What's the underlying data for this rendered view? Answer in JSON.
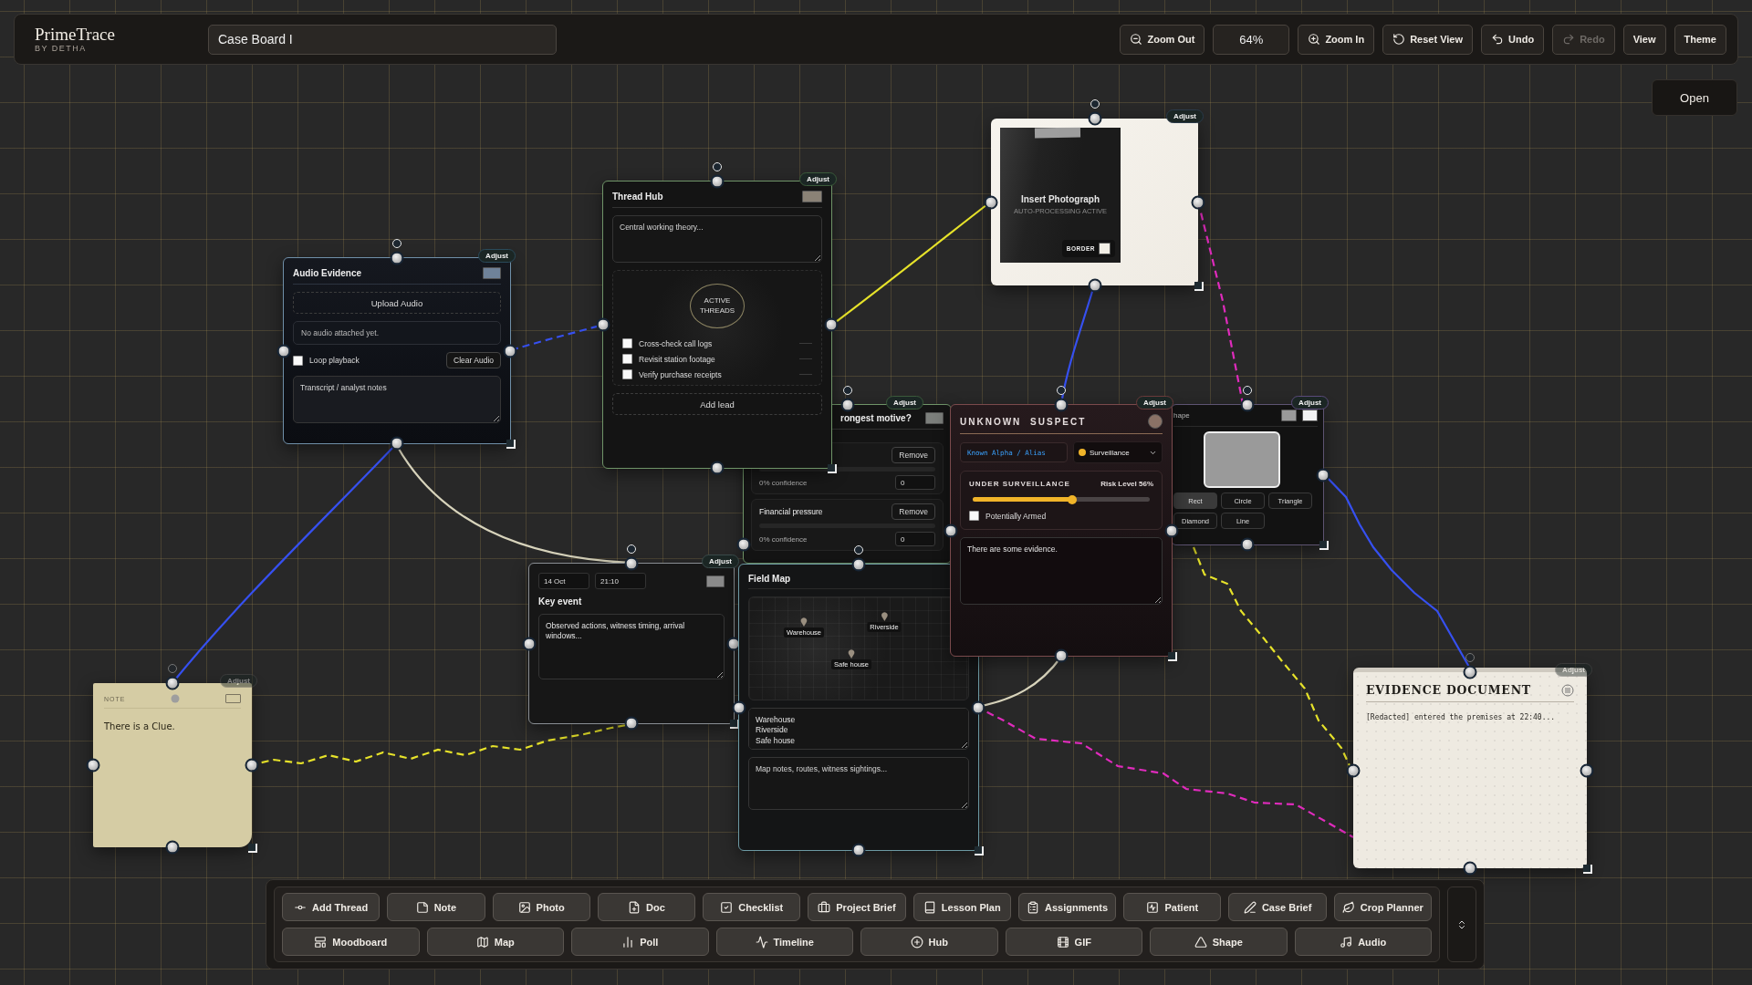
{
  "app": {
    "name": "PrimeTrace",
    "byline": "BY DETHA"
  },
  "board_title": "Case Board I",
  "controls": [
    {
      "kind": "button",
      "label": "Zoom Out",
      "disabled": false
    },
    {
      "kind": "readout",
      "label": "64%"
    },
    {
      "kind": "button",
      "label": "Zoom In",
      "disabled": false
    },
    {
      "kind": "button",
      "label": "Reset View",
      "disabled": false
    },
    {
      "kind": "button",
      "label": "Undo",
      "disabled": false
    },
    {
      "kind": "button",
      "label": "Redo",
      "disabled": true
    },
    {
      "kind": "button",
      "label": "View",
      "disabled": false
    },
    {
      "kind": "button",
      "label": "Theme",
      "disabled": false
    }
  ],
  "open_button": "Open",
  "poll_node": {
    "title": "rongest motive?",
    "adjust": "Adjust",
    "options": [
      {
        "remove": "Remove",
        "level": 0,
        "confidence": "0% confidence",
        "votes": "0"
      },
      {
        "label": "Financial pressure",
        "remove": "Remove",
        "level": 0,
        "confidence": "0% confidence",
        "votes": "0"
      }
    ]
  },
  "audio_node": {
    "title": "Audio Evidence",
    "adjust": "Adjust",
    "upload": "Upload Audio",
    "status": "No audio attached yet.",
    "loop": {
      "label": "Loop playback",
      "checked": false
    },
    "clear": "Clear Audio",
    "notes_placeholder": "Transcript / analyst notes"
  },
  "thread_hub": {
    "title": "Thread Hub",
    "adjust": "Adjust",
    "theory_placeholder": "Central working theory...",
    "badge": "ACTIVE THREADS",
    "threads": [
      {
        "label": "Cross-check call logs",
        "checked": false
      },
      {
        "label": "Revisit station footage",
        "checked": false
      },
      {
        "label": "Verify purchase receipts",
        "checked": false
      }
    ],
    "add": "Add lead"
  },
  "key_event": {
    "date": "14 Oct",
    "time": "21:10",
    "title": "Key event",
    "adjust": "Adjust",
    "details": "Observed actions, witness timing, arrival windows..."
  },
  "field_map": {
    "title": "Field Map",
    "pins": [
      "Warehouse",
      "Riverside",
      "Safe house"
    ],
    "locations": "Warehouse\nRiverside\nSafe house",
    "notes_placeholder": "Map notes, routes, witness sightings..."
  },
  "suspect": {
    "title": "UNKNOWN SUSPECT",
    "adjust": "Adjust",
    "alias_placeholder": "Known Alpha / Alias",
    "status": "Surveillance",
    "card": {
      "heading": "UNDER SURVEILLANCE",
      "risk": "Risk Level 56%",
      "level": 0.56,
      "armed": {
        "label": "Potentially Armed",
        "checked": false
      }
    },
    "notes": "There are some evidence."
  },
  "shape_node": {
    "title": "hape",
    "adjust": "Adjust",
    "shapes": [
      {
        "label": "Rect",
        "selected": true
      },
      {
        "label": "Circle",
        "selected": false
      },
      {
        "label": "Triangle",
        "selected": false
      },
      {
        "label": "Diamond",
        "selected": false
      },
      {
        "label": "Line",
        "selected": false
      }
    ]
  },
  "photo_node": {
    "adjust": "Adjust",
    "title": "Insert Photograph",
    "subtitle": "AUTO-PROCESSING ACTIVE",
    "border_label": "BORDER"
  },
  "note": {
    "label": "NOTE",
    "adjust": "Adjust",
    "text": "There is a Clue."
  },
  "evidence_document": {
    "title": "EVIDENCE DOCUMENT",
    "adjust": "Adjust",
    "body": "[Redacted] entered the premises at 22:40..."
  },
  "connectors": [
    {
      "color": "#3650f0",
      "dashed": true
    },
    {
      "color": "#e6e22a",
      "dashed": false
    },
    {
      "color": "#3650f0",
      "dashed": false
    },
    {
      "color": "#d8d4bc",
      "dashed": false
    },
    {
      "color": "#3650f0",
      "dashed": false
    },
    {
      "color": "#e02bbd",
      "dashed": true
    },
    {
      "color": "#3650f0",
      "dashed": false
    },
    {
      "color": "#e6e22a",
      "dashed": true
    },
    {
      "color": "#e6e22a",
      "dashed": true
    },
    {
      "color": "#d8d4bc",
      "dashed": false
    },
    {
      "color": "#e02bbd",
      "dashed": true
    }
  ],
  "palette": [
    [
      "Add Thread",
      "Note",
      "Photo",
      "Doc",
      "Checklist",
      "Project Brief",
      "Lesson Plan",
      "Assignments",
      "Patient",
      "Case Brief",
      "Crop Planner"
    ],
    [
      "Moodboard",
      "Map",
      "Poll",
      "Timeline",
      "Hub",
      "GIF",
      "Shape",
      "Audio"
    ]
  ]
}
